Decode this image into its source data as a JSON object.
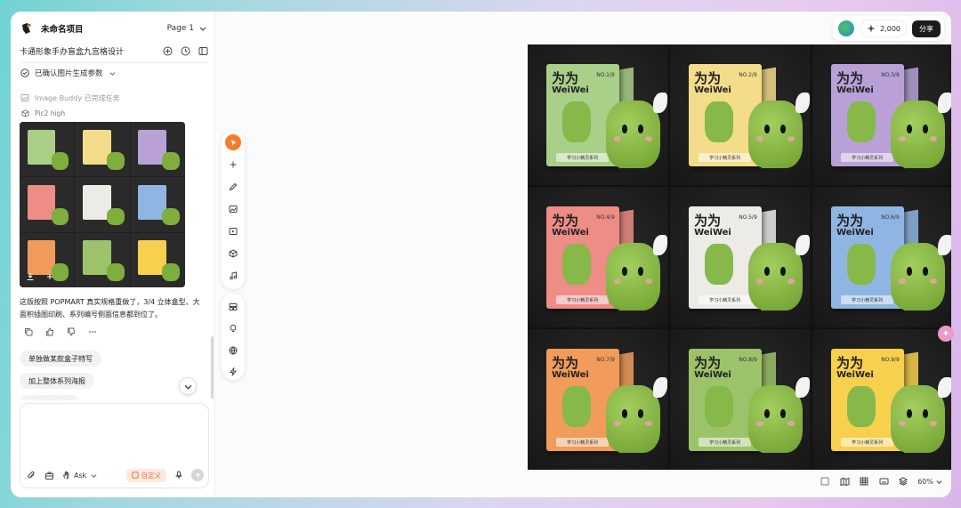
{
  "header": {
    "project_name": "未命名项目",
    "page_selector": "Page 1"
  },
  "chat": {
    "doc_title": "卡通形象手办盲盒九宫格设计",
    "confirm_label": "已确认图片生成参数",
    "task_status": "Image Buddy 已完成任务",
    "model_label": "Pic2 high",
    "reply": "这版按照 POPMART 真实规格重做了，3/4 立体盒型、大面积插图印刷、系列编号侧面信息都到位了。",
    "chips": [
      "单独做某款盒子特写",
      "加上整体系列海报",
      "调整公仔表情"
    ],
    "composer": {
      "mode": "Ask",
      "custom_label": "自定义"
    }
  },
  "topbar": {
    "credits": "2,000",
    "share": "分享"
  },
  "bottombar": {
    "zoom": "60%"
  },
  "artwork": {
    "brand_cn": "为为",
    "brand_en": "WeiWei",
    "series_text": "学习小精灵系列",
    "boxes": [
      {
        "no": "NO.1/9",
        "color": "#a9cf88"
      },
      {
        "no": "NO.2/9",
        "color": "#f3dc8a"
      },
      {
        "no": "NO.3/9",
        "color": "#b9a1d8"
      },
      {
        "no": "NO.4/9",
        "color": "#ee8c86"
      },
      {
        "no": "NO.5/9",
        "color": "#ecebe6"
      },
      {
        "no": "NO.6/9",
        "color": "#8fb6e2"
      },
      {
        "no": "NO.7/9",
        "color": "#f19c5a"
      },
      {
        "no": "NO.8/9",
        "color": "#9cc36a"
      },
      {
        "no": "NO.9/9",
        "color": "#f7d04e"
      }
    ]
  },
  "colors": {
    "accent": "#f57c2a",
    "figure": "#86b84a"
  }
}
